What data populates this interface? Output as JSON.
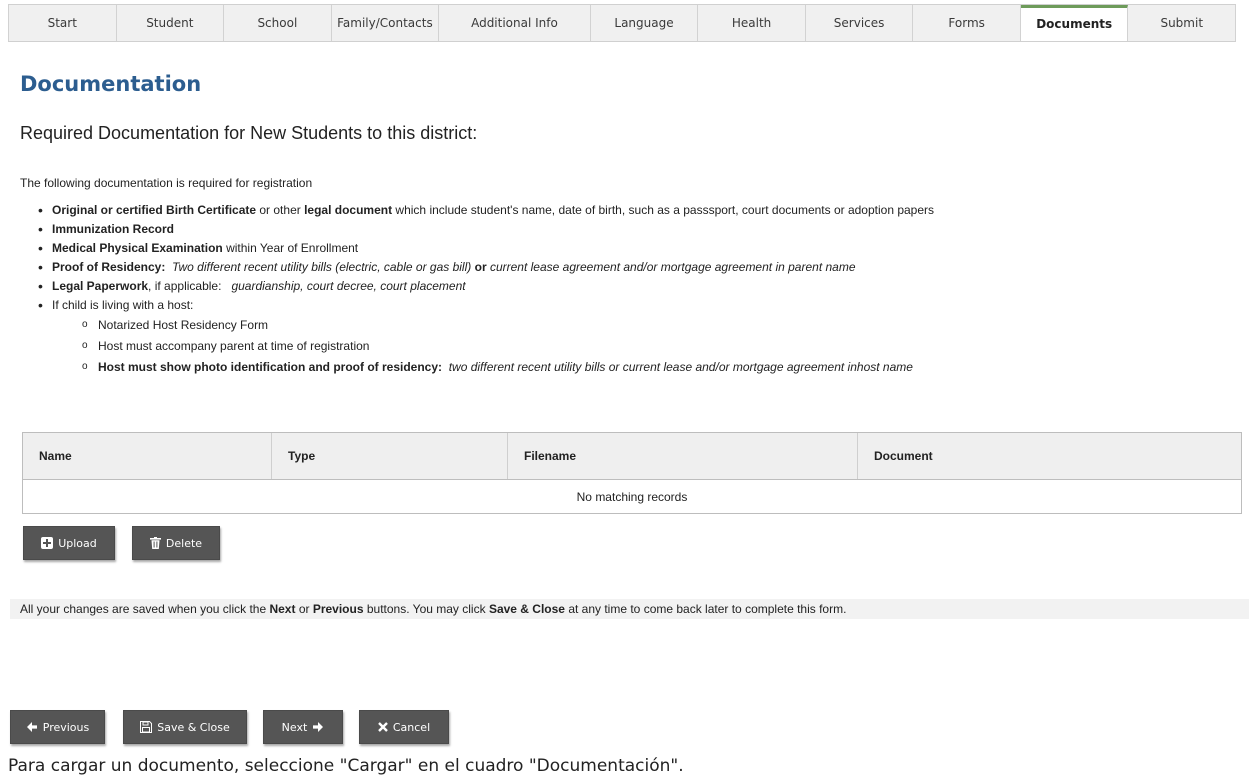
{
  "tabs": [
    {
      "label": "Start",
      "active": false
    },
    {
      "label": "Student",
      "active": false
    },
    {
      "label": "School",
      "active": false
    },
    {
      "label": "Family/Contacts",
      "active": false
    },
    {
      "label": "Additional Info",
      "active": false
    },
    {
      "label": "Language",
      "active": false
    },
    {
      "label": "Health",
      "active": false
    },
    {
      "label": "Services",
      "active": false
    },
    {
      "label": "Forms",
      "active": false
    },
    {
      "label": "Documents",
      "active": true
    },
    {
      "label": "Submit",
      "active": false
    }
  ],
  "page": {
    "title": "Documentation",
    "subtitle": "Required Documentation for New Students to this district:",
    "intro": "The following documentation is required for registration"
  },
  "requirements": {
    "birth_bold1": "Original or certified Birth Certificate",
    "birth_text1": " or other ",
    "birth_bold2": "legal document",
    "birth_text2": " which include student's name, date of birth, such as a passsport, court documents or adoption papers",
    "immunization": "Immunization Record",
    "physical_bold": "Medical Physical Examination",
    "physical_text": " within Year of Enrollment",
    "residency_bold": "Proof of Residency:",
    "residency_italic1": "Two different recent utility bills (electric, cable or gas bill)",
    "residency_or": "or",
    "residency_italic2": "current lease agreement and/or mortgage agreement in parent name",
    "legal_bold": "Legal Paperwork",
    "legal_text": ", if applicable:",
    "legal_italic": "guardianship, court decree, court placement",
    "host_intro": "If child is living with a host:",
    "host_items": {
      "form": "Notarized Host Residency Form",
      "accompany": "Host must accompany parent at time of registration",
      "id_bold": "Host must show photo identification and proof of residency:",
      "id_italic": "two different recent utility bills or current lease and/or mortgage agreement inhost name"
    }
  },
  "table": {
    "columns": [
      "Name",
      "Type",
      "Filename",
      "Document"
    ],
    "empty_message": "No matching records"
  },
  "actions": {
    "upload": "Upload",
    "delete": "Delete"
  },
  "notice": {
    "part1": "All your changes are saved when you click the ",
    "next": "Next",
    "part2": " or ",
    "previous": "Previous",
    "part3": " buttons. You may click ",
    "save_close": "Save & Close",
    "part4": " at any time to come back later to complete this form."
  },
  "nav": {
    "previous": "Previous",
    "save_close": "Save & Close",
    "next": "Next",
    "cancel": "Cancel"
  },
  "caption": "Para cargar un documento, seleccione \"Cargar\" en el cuadro \"Documentación\"."
}
